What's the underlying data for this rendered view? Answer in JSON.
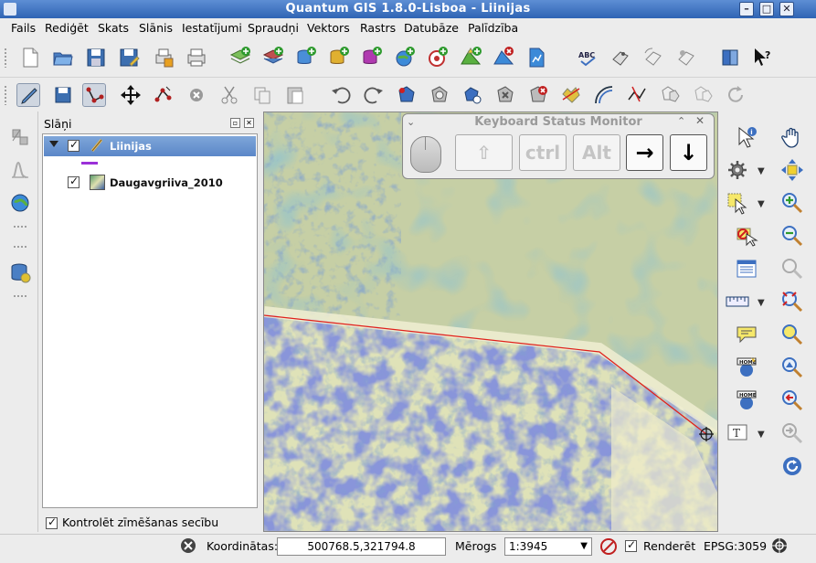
{
  "window": {
    "title": "Quantum GIS 1.8.0-Lisboa - Liinijas"
  },
  "menu": [
    "Fails",
    "Rediģēt",
    "Skats",
    "Slānis",
    "Iestatījumi",
    "Spraudņi",
    "Vektors",
    "Rastrs",
    "Datubāze",
    "Palīdzība"
  ],
  "layers_panel": {
    "title": "Slāņi",
    "layers": [
      {
        "name": "Liinijas",
        "checked": true,
        "selected": true,
        "legend_color": "#9b30d8"
      },
      {
        "name": "Daugavgriiva_2010",
        "checked": true,
        "selected": false
      }
    ],
    "render_order_checkbox": {
      "label": "Kontrolēt zīmēšanas secību",
      "checked": true
    }
  },
  "keyboard_monitor": {
    "title": "Keyboard Status Monitor",
    "keys": [
      {
        "label": "⇧",
        "active": false
      },
      {
        "label": "ctrl",
        "active": false
      },
      {
        "label": "Alt",
        "active": false
      },
      {
        "label": "→",
        "active": true
      },
      {
        "label": "↓",
        "active": true
      }
    ]
  },
  "statusbar": {
    "coords_label": "Koordinātas:",
    "coords_value": "500768.5,321794.8",
    "scale_label": "Mērogs",
    "scale_value": "1:3945",
    "render_label": "Renderēt",
    "render_checked": true,
    "crs": "EPSG:3059"
  },
  "colors": {
    "titlebar": "#3a6fc0",
    "selection": "#6b93cf",
    "line_feature": "#e0201a"
  }
}
